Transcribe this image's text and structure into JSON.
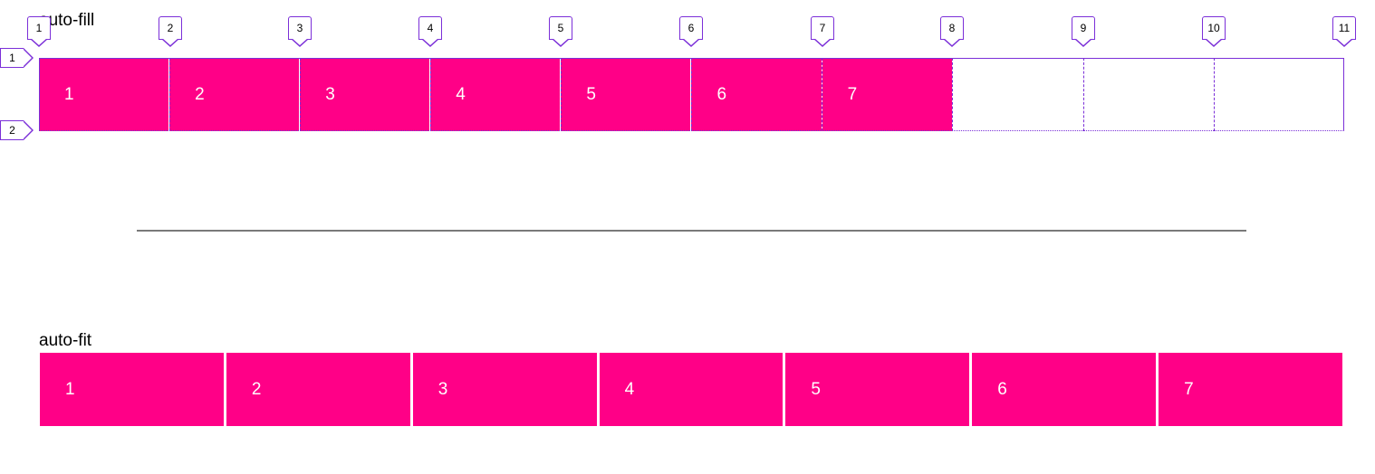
{
  "auto_fill": {
    "label": "auto-fill",
    "items": [
      "1",
      "2",
      "3",
      "4",
      "5",
      "6",
      "7"
    ],
    "column_line_numbers": [
      "1",
      "2",
      "3",
      "4",
      "5",
      "6",
      "7",
      "8",
      "9",
      "10",
      "11"
    ],
    "row_line_numbers": [
      "1",
      "2"
    ]
  },
  "auto_fit": {
    "label": "auto-fit",
    "items": [
      "1",
      "2",
      "3",
      "4",
      "5",
      "6",
      "7"
    ]
  },
  "colors": {
    "item_background": "#ff0087",
    "item_text": "#ffffff",
    "grid_overlay": "#7b2fd8",
    "divider": "#7a7a7a"
  }
}
